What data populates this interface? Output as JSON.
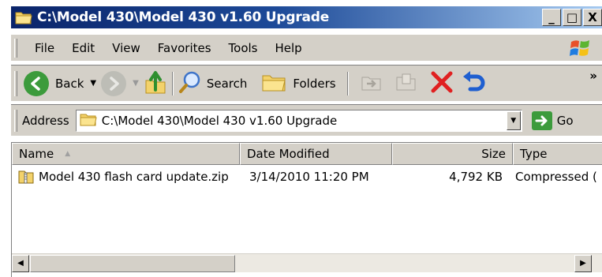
{
  "window": {
    "title": "C:\\Model 430\\Model 430 v1.60 Upgrade",
    "minimize_label": "_",
    "maximize_label": "□",
    "close_label": "X"
  },
  "menu": {
    "items": [
      "File",
      "Edit",
      "View",
      "Favorites",
      "Tools",
      "Help"
    ]
  },
  "toolbar": {
    "back_label": "Back",
    "search_label": "Search",
    "folders_label": "Folders",
    "overflow_label": "»"
  },
  "address": {
    "label": "Address",
    "value": "C:\\Model 430\\Model 430 v1.60 Upgrade",
    "go_label": "Go"
  },
  "list": {
    "columns": [
      "Name",
      "Date Modified",
      "Size",
      "Type"
    ],
    "rows": [
      {
        "name": "Model 430 flash card update.zip",
        "date_modified": "3/14/2010 11:20 PM",
        "size": "4,792 KB",
        "type": "Compressed ("
      }
    ]
  },
  "colors": {
    "titlebar_start": "#0a246a",
    "titlebar_end": "#a6caf0",
    "chrome": "#d4d0c8",
    "back_green": "#3c9b3c",
    "delete_red": "#e02020",
    "undo_blue": "#1f5fd0"
  },
  "icons": [
    "folder-icon",
    "back-arrow-icon",
    "forward-arrow-icon",
    "up-folder-icon",
    "search-icon",
    "folders-icon",
    "move-to-icon",
    "copy-to-icon",
    "delete-icon",
    "undo-icon",
    "windows-logo-icon",
    "go-arrow-icon",
    "zip-file-icon"
  ]
}
